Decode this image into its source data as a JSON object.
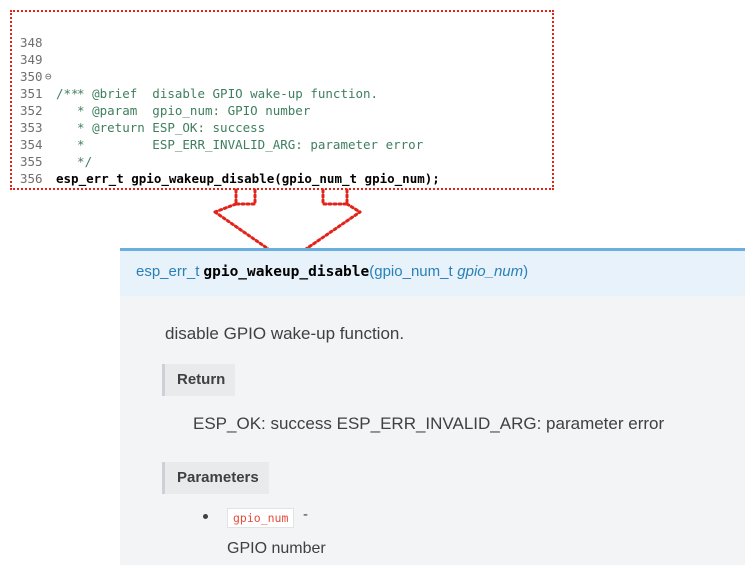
{
  "code": {
    "lines": [
      {
        "num": "348",
        "text": ""
      },
      {
        "num": "349",
        "fold": "⊖",
        "text": "/**"
      },
      {
        "num": "350",
        "text": "  * @brief  disable GPIO wake-up function."
      },
      {
        "num": "351",
        "text": "  * @param  gpio_num: GPIO number"
      },
      {
        "num": "352",
        "text": "  * @return ESP_OK: success"
      },
      {
        "num": "353",
        "text": "  *         ESP_ERR_INVALID_ARG: parameter error"
      },
      {
        "num": "354",
        "text": "  */"
      },
      {
        "num": "355",
        "text": "esp_err_t gpio_wakeup_disable(gpio_num_t gpio_num);"
      },
      {
        "num": "356",
        "text": ""
      }
    ]
  },
  "doc": {
    "return_type": "esp_err_t",
    "function_name": "gpio_wakeup_disable",
    "open_paren": "(",
    "param_type": "gpio_num_t",
    "param_name": "gpio_num",
    "close_paren": ")",
    "brief": "disable GPIO wake-up function.",
    "return_label": "Return",
    "return_text": "ESP_OK: success ESP_ERR_INVALID_ARG: parameter error",
    "parameters_label": "Parameters",
    "param_code": "gpio_num",
    "param_dash": "-",
    "param_description": "GPIO number"
  },
  "colors": {
    "annotation_red": "#e2231a",
    "comment_green": "#3f7f5f",
    "link_blue": "#2980b9",
    "signature_bar": "#e7f2fa"
  }
}
